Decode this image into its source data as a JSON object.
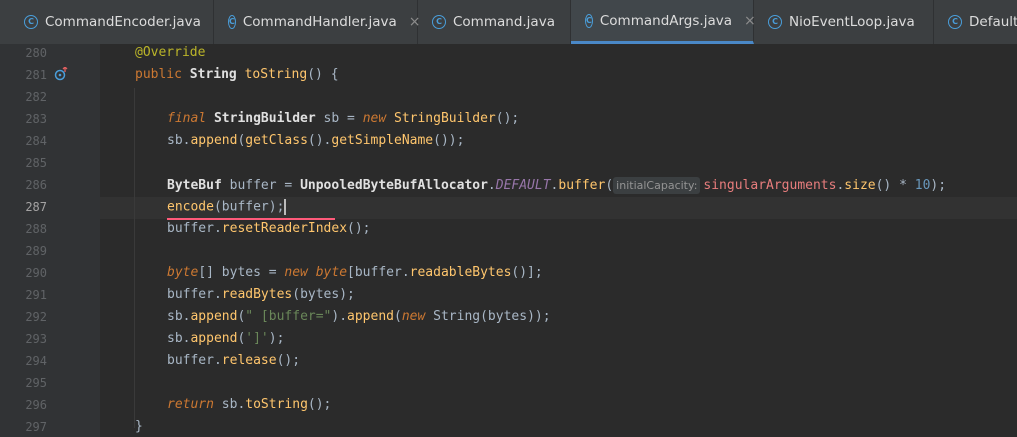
{
  "tabs": [
    {
      "label": "CommandEncoder.java"
    },
    {
      "label": "CommandHandler.java",
      "close": "×"
    },
    {
      "label": "Command.java"
    },
    {
      "label": "CommandArgs.java",
      "close": "×"
    },
    {
      "label": "NioEventLoop.java"
    },
    {
      "label": "DefaultE"
    }
  ],
  "class_icon_letter": "C",
  "line_numbers": [
    "280",
    "281",
    "282",
    "283",
    "284",
    "285",
    "286",
    "287",
    "288",
    "289",
    "290",
    "291",
    "292",
    "293",
    "294",
    "295",
    "296",
    "297"
  ],
  "code": {
    "l280": {
      "a": "@Override"
    },
    "l281": {
      "kw": "public",
      "t": "String",
      "m": "toString",
      "p": "() {"
    },
    "l283": {
      "final": "final",
      "type": "StringBuilder",
      "var": " sb = ",
      "new": "new",
      "ctor": "StringBuilder",
      "end": "();"
    },
    "l284": {
      "a": "sb.",
      "m1": "append",
      "b": "(",
      "m2": "getClass",
      "c": "().",
      "m3": "getSimpleName",
      "d": "());"
    },
    "l286": {
      "type": "ByteBuf",
      "var": " buffer = ",
      "cls": "UnpooledByteBufAllocator",
      "dot": ".",
      "const": "DEFAULT",
      "dot2": ".",
      "m": "buffer",
      "open": "(",
      "hint": "initialCapacity:",
      "field": "singularArguments",
      "dot3": ".",
      "m2": "size",
      "rest": "() * ",
      "num": "10",
      "end": ");"
    },
    "l287": {
      "m": "encode",
      "args": "(buffer);"
    },
    "l288": {
      "a": "buffer.",
      "m": "resetReaderIndex",
      "end": "();"
    },
    "l290": {
      "kw": "byte",
      "a": "[] bytes = ",
      "new": "new",
      "kw2": "byte",
      "b": "[buffer.",
      "m": "readableBytes",
      "end": "()];"
    },
    "l291": {
      "a": "buffer.",
      "m": "readBytes",
      "end": "(bytes);"
    },
    "l292": {
      "a": "sb.",
      "m1": "append",
      "b": "(",
      "s": "\" [buffer=\"",
      "c": ").",
      "m2": "append",
      "d": "(",
      "new": "new",
      "t": " String",
      "e": "(bytes));"
    },
    "l293": {
      "a": "sb.",
      "m1": "append",
      "b": "(",
      "s": "']'",
      "end": ");"
    },
    "l294": {
      "a": "buffer.",
      "m": "release",
      "end": "();"
    },
    "l296": {
      "kw": "return",
      "a": " sb.",
      "m": "toString",
      "end": "();"
    },
    "l297": {
      "a": "}"
    }
  },
  "colors": {
    "keyword": "#cc7832",
    "method": "#ffc66d",
    "string": "#6a8759",
    "number": "#6897bb",
    "annotation": "#bbb529",
    "error_underline": "#ff5a7a",
    "tab_accent": "#4a88c7"
  },
  "icons": {
    "tab_file": "java-class-icon",
    "gutter": "override-method-icon"
  }
}
